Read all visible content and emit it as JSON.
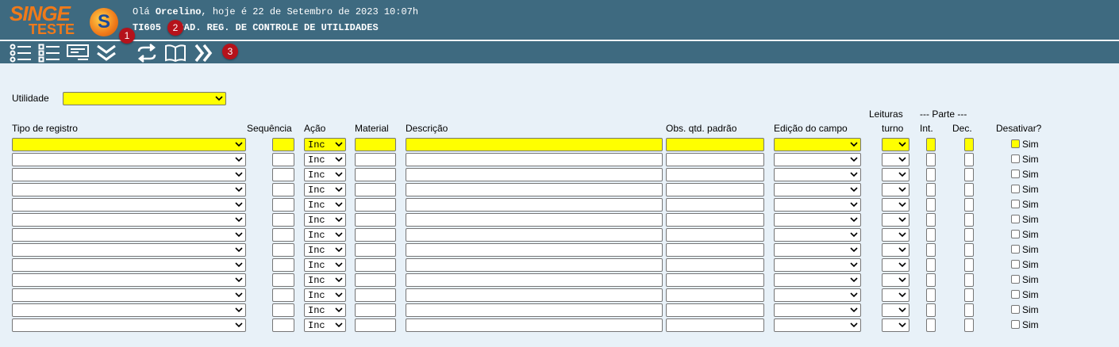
{
  "header": {
    "logo_text": "SINGE",
    "logo_sub": "TESTE",
    "greeting_prefix": "Olá ",
    "user": "Orcelino",
    "greeting_suffix": ", hoje é 22 de Setembro de 2023 10:07h",
    "screen_title": "TI605 - CAD. REG. DE CONTROLE DE UTILIDADES"
  },
  "toolbar": {
    "icons": [
      "list-icon",
      "checklist-icon",
      "card-icon",
      "double-chevron-down-icon",
      "refresh-icon",
      "book-icon",
      "double-chevron-right-icon"
    ],
    "badges": [
      "1",
      "2",
      "3"
    ]
  },
  "form": {
    "utilidade_label": "Utilidade",
    "utilidade_value": ""
  },
  "columns": {
    "tipo": "Tipo de registro",
    "sequencia": "Sequência",
    "acao": "Ação",
    "material": "Material",
    "descricao": "Descrição",
    "obs": "Obs. qtd. padrão",
    "edicao": "Edição do campo",
    "leituras_top": "Leituras",
    "leituras_bottom": "turno",
    "parte": "--- Parte ---",
    "int": "Int.",
    "dec": "Dec.",
    "desativar": "Desativar?"
  },
  "rows": [
    {
      "acao": "Inc",
      "desativar": "Sim"
    },
    {
      "acao": "Inc",
      "desativar": "Sim"
    },
    {
      "acao": "Inc",
      "desativar": "Sim"
    },
    {
      "acao": "Inc",
      "desativar": "Sim"
    },
    {
      "acao": "Inc",
      "desativar": "Sim"
    },
    {
      "acao": "Inc",
      "desativar": "Sim"
    },
    {
      "acao": "Inc",
      "desativar": "Sim"
    },
    {
      "acao": "Inc",
      "desativar": "Sim"
    },
    {
      "acao": "Inc",
      "desativar": "Sim"
    },
    {
      "acao": "Inc",
      "desativar": "Sim"
    },
    {
      "acao": "Inc",
      "desativar": "Sim"
    },
    {
      "acao": "Inc",
      "desativar": "Sim"
    },
    {
      "acao": "Inc",
      "desativar": "Sim"
    }
  ],
  "colors": {
    "header_bg": "#3e6a80",
    "page_bg": "#e8f1f8",
    "highlight": "#ffff00",
    "brand_orange": "#f07a1a",
    "badge_red": "#b5121b"
  }
}
